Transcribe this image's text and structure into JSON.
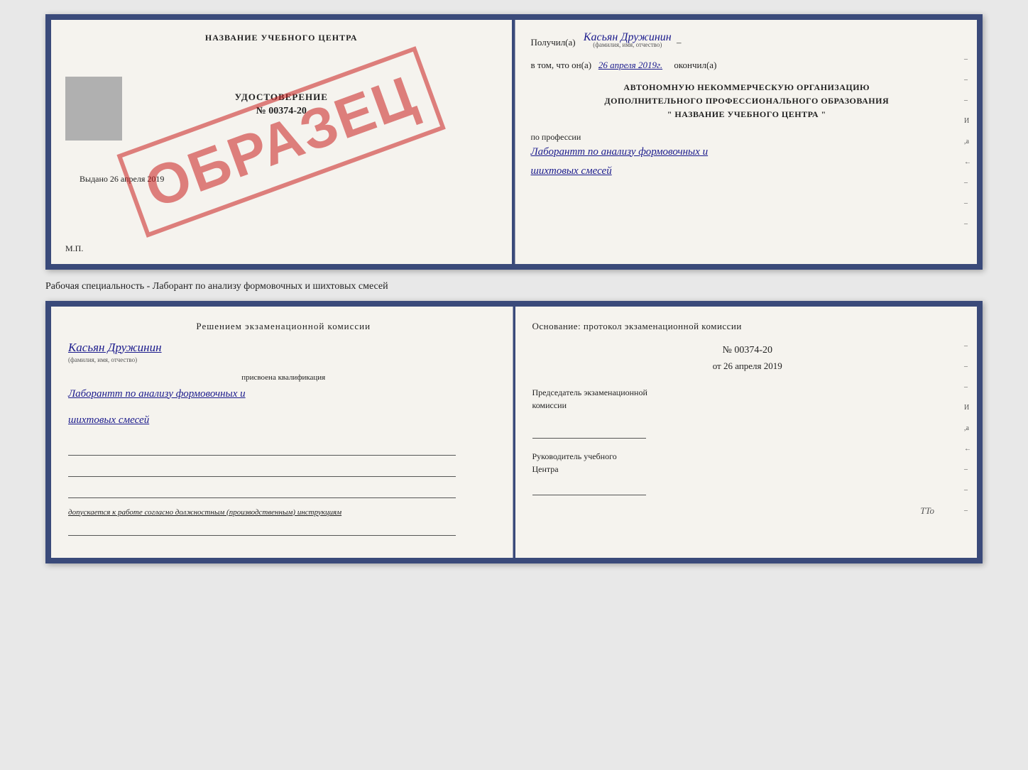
{
  "topCert": {
    "left": {
      "title": "НАЗВАНИЕ УЧЕБНОГО ЦЕНТРА",
      "udost_label": "УДОСТОВЕРЕНИЕ",
      "udost_number": "№ 00374-20",
      "vydano": "Выдано 26 апреля 2019",
      "mp": "М.П.",
      "obrazec": "ОБРАЗЕЦ"
    },
    "right": {
      "poluchil": "Получил(а)",
      "poluchil_name": "Касьян Дружинин",
      "poluchil_subtitle": "(фамилия, имя, отчество)",
      "vtom_prefix": "в том, что он(а)",
      "vtom_date": "26 апреля 2019г.",
      "okonchil": "окончил(а)",
      "avtonom_line1": "АВТОНОМНУЮ НЕКОММЕРЧЕСКУЮ ОРГАНИЗАЦИЮ",
      "avtonom_line2": "ДОПОЛНИТЕЛЬНОГО ПРОФЕССИОНАЛЬНОГО ОБРАЗОВАНИЯ",
      "avtonom_line3": "\"  НАЗВАНИЕ УЧЕБНОГО ЦЕНТРА  \"",
      "po_professii": "по профессии",
      "professiya_line1": "Лаборантт по анализу формовочных и",
      "professiya_line2": "шихтовых смесей"
    }
  },
  "specialtyText": "Рабочая специальность - Лаборант по анализу формовочных и шихтовых смесей",
  "bottomCert": {
    "left": {
      "resheniem": "Решением экзаменационной комиссии",
      "kasyan_name": "Касьян Дружинин",
      "familiya_subtitle": "(фамилия, имя, отчество)",
      "prisvoena": "присвоена квалификация",
      "kval_line1": "Лаборантт по анализу формовочных и",
      "kval_line2": "шихтовых смесей",
      "dopuskaetsya": "допускается к  работе согласно должностным (производственным) инструкциям"
    },
    "right": {
      "osnovaniye": "Основание: протокол экзаменационной комиссии",
      "protocol_number": "№ 00374-20",
      "ot_prefix": "от",
      "ot_date": "26 апреля 2019",
      "predsedatel_line1": "Председатель экзаменационной",
      "predsedatel_line2": "комиссии",
      "rukovoditel_line1": "Руководитель учебного",
      "rukovoditel_line2": "Центра"
    }
  },
  "rightMarks": [
    "-",
    "-",
    "-",
    "И",
    ",а",
    "←",
    "-",
    "-",
    "-"
  ],
  "ttoMark": "TTo"
}
